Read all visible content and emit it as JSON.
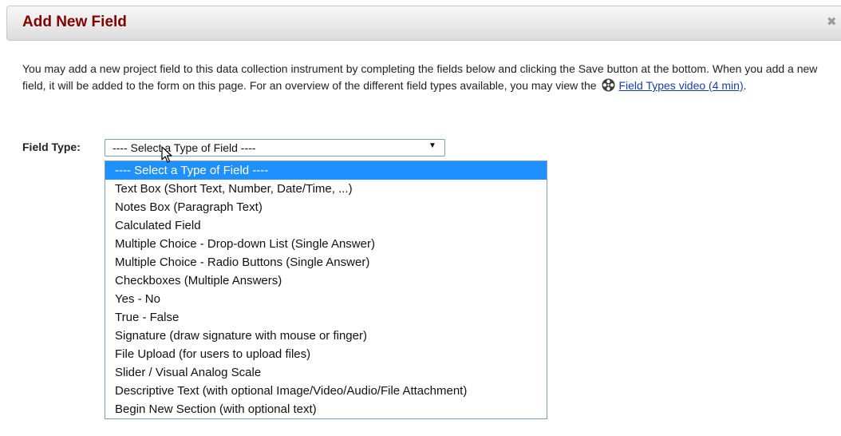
{
  "dialog": {
    "title": "Add New Field",
    "close_icon": "close-icon"
  },
  "intro": {
    "text_before_icon": "You may add a new project field to this data collection instrument by completing the fields below and clicking the Save button at the bottom. When you add a new field, it will be added to the form on this page. For an overview of the different field types available, you may view the",
    "video_icon": "film-reel-icon",
    "link_text": "Field Types video (4 min)",
    "text_after_link": "."
  },
  "field_type": {
    "label": "Field Type:",
    "selected_value": "---- Select a Type of Field ----",
    "options": [
      "---- Select a Type of Field ----",
      "Text Box (Short Text, Number, Date/Time, ...)",
      "Notes Box (Paragraph Text)",
      "Calculated Field",
      "Multiple Choice - Drop-down List (Single Answer)",
      "Multiple Choice - Radio Buttons (Single Answer)",
      "Checkboxes (Multiple Answers)",
      "Yes - No",
      "True - False",
      "Signature (draw signature with mouse or finger)",
      "File Upload (for users to upload files)",
      "Slider / Visual Analog Scale",
      "Descriptive Text (with optional Image/Video/Audio/File Attachment)",
      "Begin New Section (with optional text)"
    ],
    "highlighted_index": 0
  },
  "colors": {
    "title": "#800000",
    "link": "#1a3ea8",
    "highlight": "#1e90ff"
  }
}
